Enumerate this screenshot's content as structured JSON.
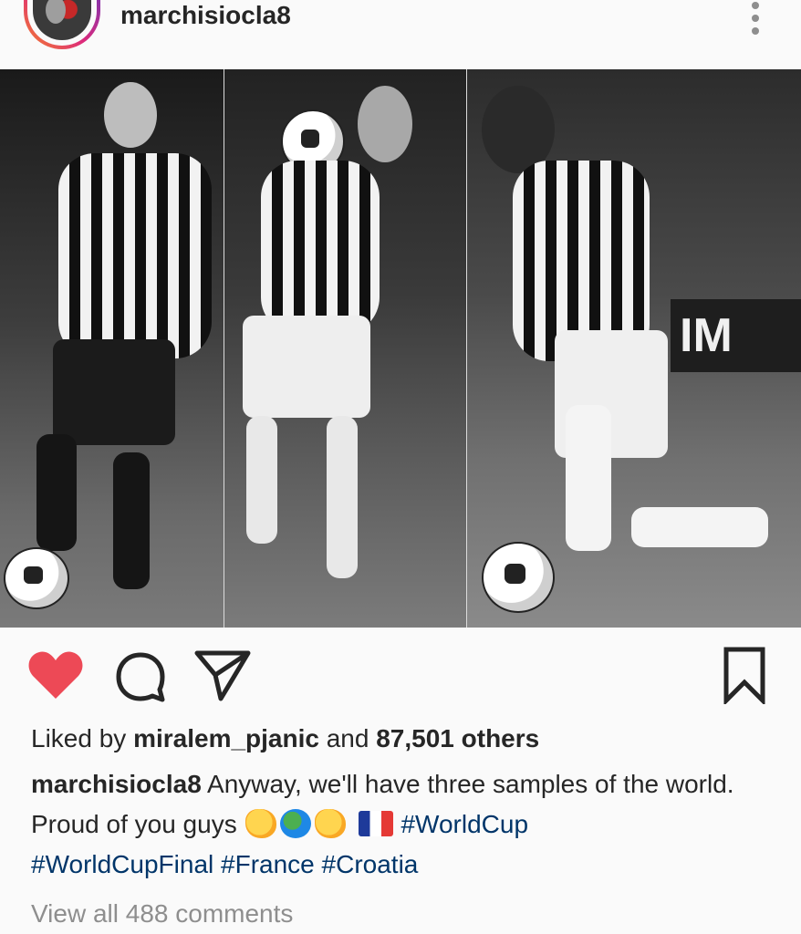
{
  "post": {
    "username": "marchisiocla8",
    "avatar_icon": "user-avatar",
    "more_icon": "more-vertical-icon"
  },
  "photo": {
    "sign_text": "IM"
  },
  "actions": {
    "like_icon": "heart-filled-icon",
    "comment_icon": "comment-icon",
    "share_icon": "send-icon",
    "save_icon": "bookmark-icon",
    "like_color": "#ed4956"
  },
  "likes": {
    "prefix": "Liked by ",
    "user": "miralem_pjanic",
    "middle": " and ",
    "count": "87,501 others"
  },
  "caption": {
    "username": "marchisiocla8",
    "text": " Anyway, we'll have three samples of the world. Proud of you guys ",
    "emoji": [
      "clapping-hands",
      "globe",
      "clapping-hands",
      "france-flag"
    ],
    "hashtags": [
      "#WorldCup",
      "#WorldCupFinal",
      "#France",
      "#Croatia"
    ]
  },
  "comments": {
    "view_all": "View all 488 comments"
  },
  "colors": {
    "link": "#003569",
    "muted": "#8e8e8e",
    "text": "#262626"
  }
}
